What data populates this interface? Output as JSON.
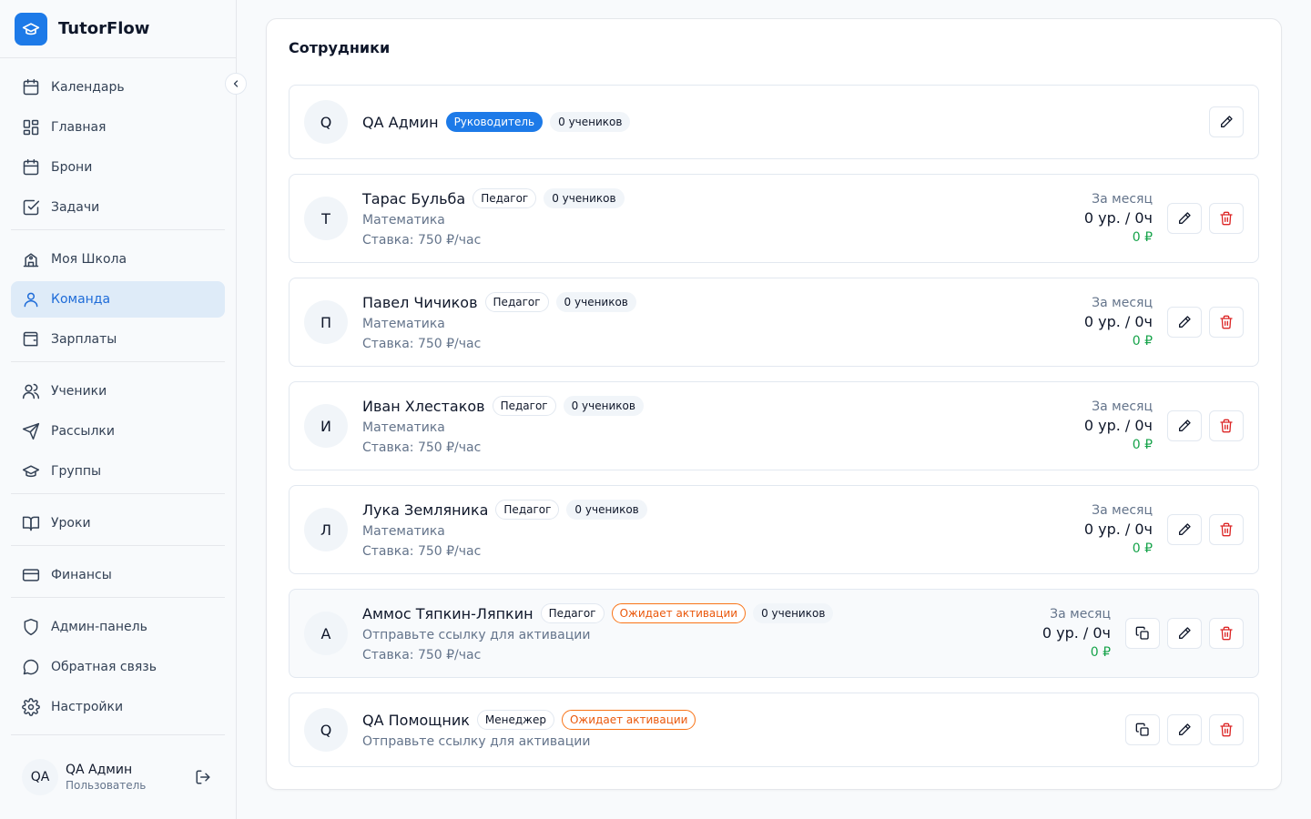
{
  "app": {
    "name": "TutorFlow"
  },
  "sidebar": {
    "groups": [
      [
        {
          "label": "Календарь",
          "icon": "calendar-icon"
        },
        {
          "label": "Главная",
          "icon": "dashboard-icon"
        },
        {
          "label": "Брони",
          "icon": "calendar-icon"
        },
        {
          "label": "Задачи",
          "icon": "checkbox-icon"
        }
      ],
      [
        {
          "label": "Моя Школа",
          "icon": "school-icon"
        },
        {
          "label": "Команда",
          "icon": "user-icon",
          "active": true
        },
        {
          "label": "Зарплаты",
          "icon": "wallet-icon"
        }
      ],
      [
        {
          "label": "Ученики",
          "icon": "users-icon"
        },
        {
          "label": "Рассылки",
          "icon": "send-icon"
        },
        {
          "label": "Группы",
          "icon": "graduation-cap-icon"
        }
      ],
      [
        {
          "label": "Уроки",
          "icon": "book-icon"
        }
      ],
      [
        {
          "label": "Финансы",
          "icon": "credit-card-icon"
        }
      ],
      [
        {
          "label": "Админ-панель",
          "icon": "shield-icon"
        },
        {
          "label": "Обратная связь",
          "icon": "message-icon"
        },
        {
          "label": "Настройки",
          "icon": "gear-icon"
        }
      ]
    ],
    "user": {
      "initials": "QA",
      "name": "QA Админ",
      "role": "Пользователь"
    }
  },
  "main": {
    "title": "Сотрудники",
    "staff": [
      {
        "initial": "Q",
        "name": "QA Админ",
        "role": "Руководитель",
        "role_style": "primary",
        "students": "0 учеников"
      },
      {
        "initial": "Т",
        "name": "Тарас Бульба",
        "role": "Педагог",
        "students": "0 учеников",
        "subject": "Математика",
        "rate": "Ставка: 750 ₽/час",
        "stats_label": "За месяц",
        "stats_value": "0 ур. / 0ч",
        "stats_money": "0 ₽"
      },
      {
        "initial": "П",
        "name": "Павел Чичиков",
        "role": "Педагог",
        "students": "0 учеников",
        "subject": "Математика",
        "rate": "Ставка: 750 ₽/час",
        "stats_label": "За месяц",
        "stats_value": "0 ур. / 0ч",
        "stats_money": "0 ₽"
      },
      {
        "initial": "И",
        "name": "Иван Хлестаков",
        "role": "Педагог",
        "students": "0 учеников",
        "subject": "Математика",
        "rate": "Ставка: 750 ₽/час",
        "stats_label": "За месяц",
        "stats_value": "0 ур. / 0ч",
        "stats_money": "0 ₽"
      },
      {
        "initial": "Л",
        "name": "Лука Земляника",
        "role": "Педагог",
        "students": "0 учеников",
        "subject": "Математика",
        "rate": "Ставка: 750 ₽/час",
        "stats_label": "За месяц",
        "stats_value": "0 ур. / 0ч",
        "stats_money": "0 ₽"
      },
      {
        "initial": "А",
        "name": "Аммос Тяпкин-Ляпкин",
        "role": "Педагог",
        "status": "Ожидает активации",
        "students": "0 учеников",
        "subject": "Отправьте ссылку для активации",
        "rate": "Ставка: 750 ₽/час",
        "stats_label": "За месяц",
        "stats_value": "0 ур. / 0ч",
        "stats_money": "0 ₽"
      },
      {
        "initial": "Q",
        "name": "QA Помощник",
        "role": "Менеджер",
        "status": "Ожидает активации",
        "subject": "Отправьте ссылку для активации"
      }
    ]
  },
  "colors": {
    "accent": "#1d7ae8",
    "danger": "#dc2626",
    "success": "#16a34a",
    "warning": "#ea580c"
  }
}
